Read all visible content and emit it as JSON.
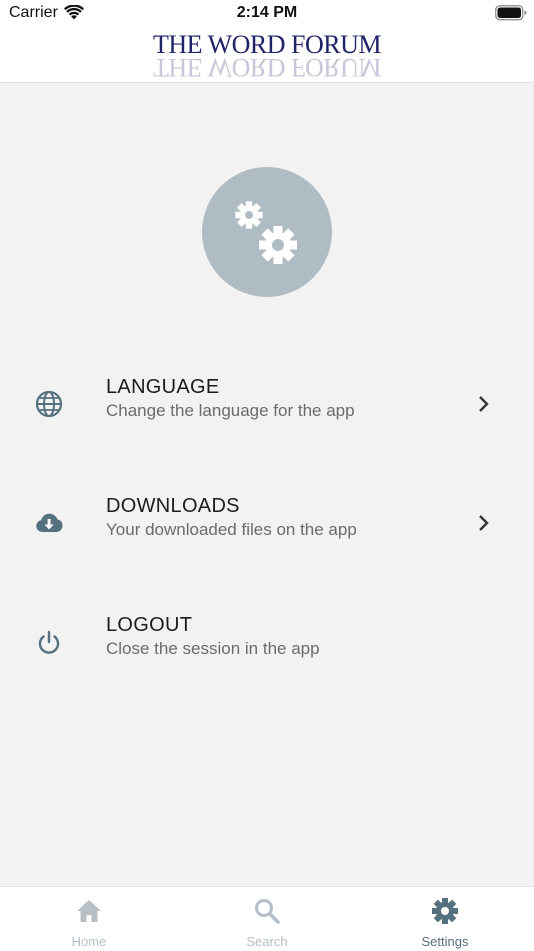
{
  "status_bar": {
    "carrier": "Carrier",
    "time": "2:14 PM"
  },
  "header": {
    "logo_text": "THE WORD FORUM",
    "logo_color": "#1f2469"
  },
  "hero": {
    "icon": "gears-icon",
    "circle_color": "#b0bcc3"
  },
  "menu": {
    "items": [
      {
        "icon": "globe-icon",
        "title": "LANGUAGE",
        "subtitle": "Change the language for the app",
        "has_chevron": true
      },
      {
        "icon": "cloud-download-icon",
        "title": "DOWNLOADS",
        "subtitle": "Your downloaded files on the app",
        "has_chevron": true
      },
      {
        "icon": "power-icon",
        "title": "LOGOUT",
        "subtitle": "Close the session in the app",
        "has_chevron": false
      }
    ]
  },
  "tab_bar": {
    "tabs": [
      {
        "icon": "home-icon",
        "label": "Home",
        "active": false
      },
      {
        "icon": "search-icon",
        "label": "Search",
        "active": false
      },
      {
        "icon": "gear-icon",
        "label": "Settings",
        "active": true
      }
    ],
    "active_color": "#55707e",
    "inactive_color": "#b7bfc6"
  },
  "colors": {
    "icon_color": "#55707e",
    "background": "#f2f2f2"
  }
}
